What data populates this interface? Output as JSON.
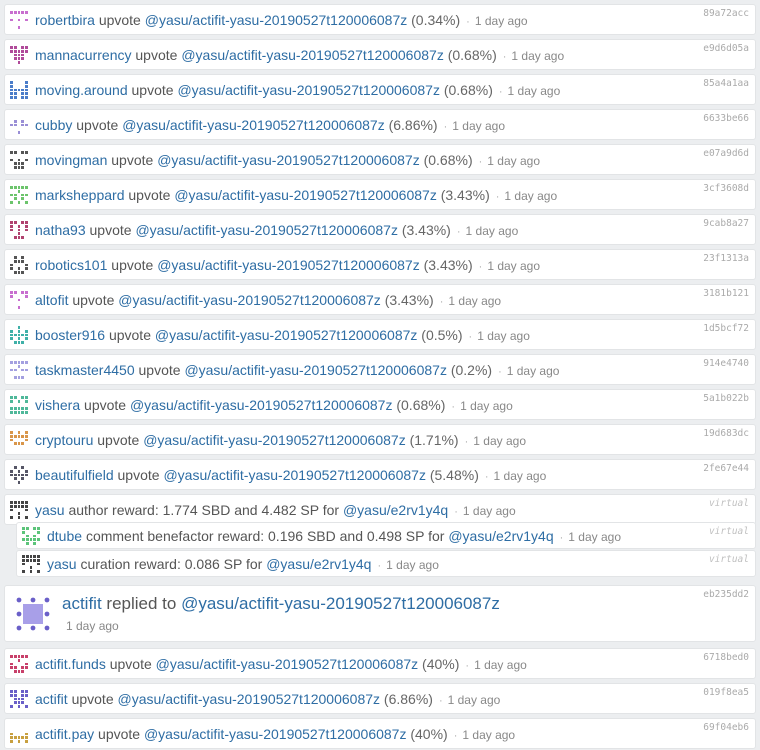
{
  "items": [
    {
      "kind": "vote",
      "user": "robertbira",
      "action": "upvote",
      "permlink": "@yasu/actifit-yasu-20190527t120006087z",
      "pct": "(0.34%)",
      "sep": "·",
      "time": "1 day ago",
      "hash": "89a72acc",
      "avatar_color": "#c86fcf"
    },
    {
      "kind": "vote",
      "user": "mannacurrency",
      "action": "upvote",
      "permlink": "@yasu/actifit-yasu-20190527t120006087z",
      "pct": "(0.68%)",
      "sep": "·",
      "time": "1 day ago",
      "hash": "e9d6d05a",
      "avatar_color": "#b04a9a"
    },
    {
      "kind": "vote",
      "user": "moving.around",
      "action": "upvote",
      "permlink": "@yasu/actifit-yasu-20190527t120006087z",
      "pct": "(0.68%)",
      "sep": "·",
      "time": "1 day ago",
      "hash": "85a4a1aa",
      "avatar_color": "#4a7cc9"
    },
    {
      "kind": "vote",
      "user": "cubby",
      "action": "upvote",
      "permlink": "@yasu/actifit-yasu-20190527t120006087z",
      "pct": "(6.86%)",
      "sep": "·",
      "time": "1 day ago",
      "hash": "6633be66",
      "avatar_color": "#9a8fd6"
    },
    {
      "kind": "vote",
      "user": "movingman",
      "action": "upvote",
      "permlink": "@yasu/actifit-yasu-20190527t120006087z",
      "pct": "(0.68%)",
      "sep": "·",
      "time": "1 day ago",
      "hash": "e07a9d6d",
      "avatar_color": "#555555"
    },
    {
      "kind": "vote",
      "user": "marksheppard",
      "action": "upvote",
      "permlink": "@yasu/actifit-yasu-20190527t120006087z",
      "pct": "(3.43%)",
      "sep": "·",
      "time": "1 day ago",
      "hash": "3cf3608d",
      "avatar_color": "#6cc46c"
    },
    {
      "kind": "vote",
      "user": "natha93",
      "action": "upvote",
      "permlink": "@yasu/actifit-yasu-20190527t120006087z",
      "pct": "(3.43%)",
      "sep": "·",
      "time": "1 day ago",
      "hash": "9cab8a27",
      "avatar_color": "#b0426f"
    },
    {
      "kind": "vote",
      "user": "robotics101",
      "action": "upvote",
      "permlink": "@yasu/actifit-yasu-20190527t120006087z",
      "pct": "(3.43%)",
      "sep": "·",
      "time": "1 day ago",
      "hash": "23f1313a",
      "avatar_color": "#555555"
    },
    {
      "kind": "vote",
      "user": "altofit",
      "action": "upvote",
      "permlink": "@yasu/actifit-yasu-20190527t120006087z",
      "pct": "(3.43%)",
      "sep": "·",
      "time": "1 day ago",
      "hash": "3181b121",
      "avatar_color": "#c86fcf"
    },
    {
      "kind": "vote",
      "user": "booster916",
      "action": "upvote",
      "permlink": "@yasu/actifit-yasu-20190527t120006087z",
      "pct": "(0.5%)",
      "sep": "·",
      "time": "1 day ago",
      "hash": "1d5bcf72",
      "avatar_color": "#3fb0a8"
    },
    {
      "kind": "vote",
      "user": "taskmaster4450",
      "action": "upvote",
      "permlink": "@yasu/actifit-yasu-20190527t120006087z",
      "pct": "(0.2%)",
      "sep": "·",
      "time": "1 day ago",
      "hash": "914e4740",
      "avatar_color": "#a4a0e0"
    },
    {
      "kind": "vote",
      "user": "vishera",
      "action": "upvote",
      "permlink": "@yasu/actifit-yasu-20190527t120006087z",
      "pct": "(0.68%)",
      "sep": "·",
      "time": "1 day ago",
      "hash": "5a1b022b",
      "avatar_color": "#4fb89a"
    },
    {
      "kind": "vote",
      "user": "cryptouru",
      "action": "upvote",
      "permlink": "@yasu/actifit-yasu-20190527t120006087z",
      "pct": "(1.71%)",
      "sep": "·",
      "time": "1 day ago",
      "hash": "19d683dc",
      "avatar_color": "#d9964a"
    },
    {
      "kind": "vote",
      "user": "beautifulfield",
      "action": "upvote",
      "permlink": "@yasu/actifit-yasu-20190527t120006087z",
      "pct": "(5.48%)",
      "sep": "·",
      "time": "1 day ago",
      "hash": "2fe67e44",
      "avatar_color": "#555566"
    },
    {
      "kind": "reward",
      "user": "yasu",
      "text": "author reward: 1.774 SBD and 4.482 SP for",
      "permlink": "@yasu/e2rv1y4q",
      "sep": "·",
      "time": "1 day ago",
      "hash": "virtual",
      "avatar_color": "#444444"
    },
    {
      "kind": "reward-sub",
      "user": "dtube",
      "text": "comment benefactor reward: 0.196 SBD and 0.498 SP for",
      "permlink": "@yasu/e2rv1y4q",
      "sep": "·",
      "time": "1 day ago",
      "hash": "virtual",
      "avatar_color": "#5cc47a"
    },
    {
      "kind": "reward-sub",
      "user": "yasu",
      "text": "curation reward: 0.086 SP for",
      "permlink": "@yasu/e2rv1y4q",
      "sep": "·",
      "time": "1 day ago",
      "hash": "virtual",
      "avatar_color": "#444444"
    },
    {
      "kind": "reply",
      "user": "actifit",
      "text": "replied to",
      "permlink": "@yasu/actifit-yasu-20190527t120006087z",
      "time": "1 day ago",
      "hash": "eb235dd2",
      "avatar_color": "#6a5fc8"
    },
    {
      "kind": "vote",
      "user": "actifit.funds",
      "action": "upvote",
      "permlink": "@yasu/actifit-yasu-20190527t120006087z",
      "pct": "(40%)",
      "sep": "·",
      "time": "1 day ago",
      "hash": "6718bed0",
      "avatar_color": "#c8406a"
    },
    {
      "kind": "vote",
      "user": "actifit",
      "action": "upvote",
      "permlink": "@yasu/actifit-yasu-20190527t120006087z",
      "pct": "(6.86%)",
      "sep": "·",
      "time": "1 day ago",
      "hash": "019f8ea5",
      "avatar_color": "#6a5fc8"
    },
    {
      "kind": "vote",
      "user": "actifit.pay",
      "action": "upvote",
      "permlink": "@yasu/actifit-yasu-20190527t120006087z",
      "pct": "(40%)",
      "sep": "·",
      "time": "1 day ago",
      "hash": "69f04eb6",
      "avatar_color": "#c8a040"
    }
  ]
}
